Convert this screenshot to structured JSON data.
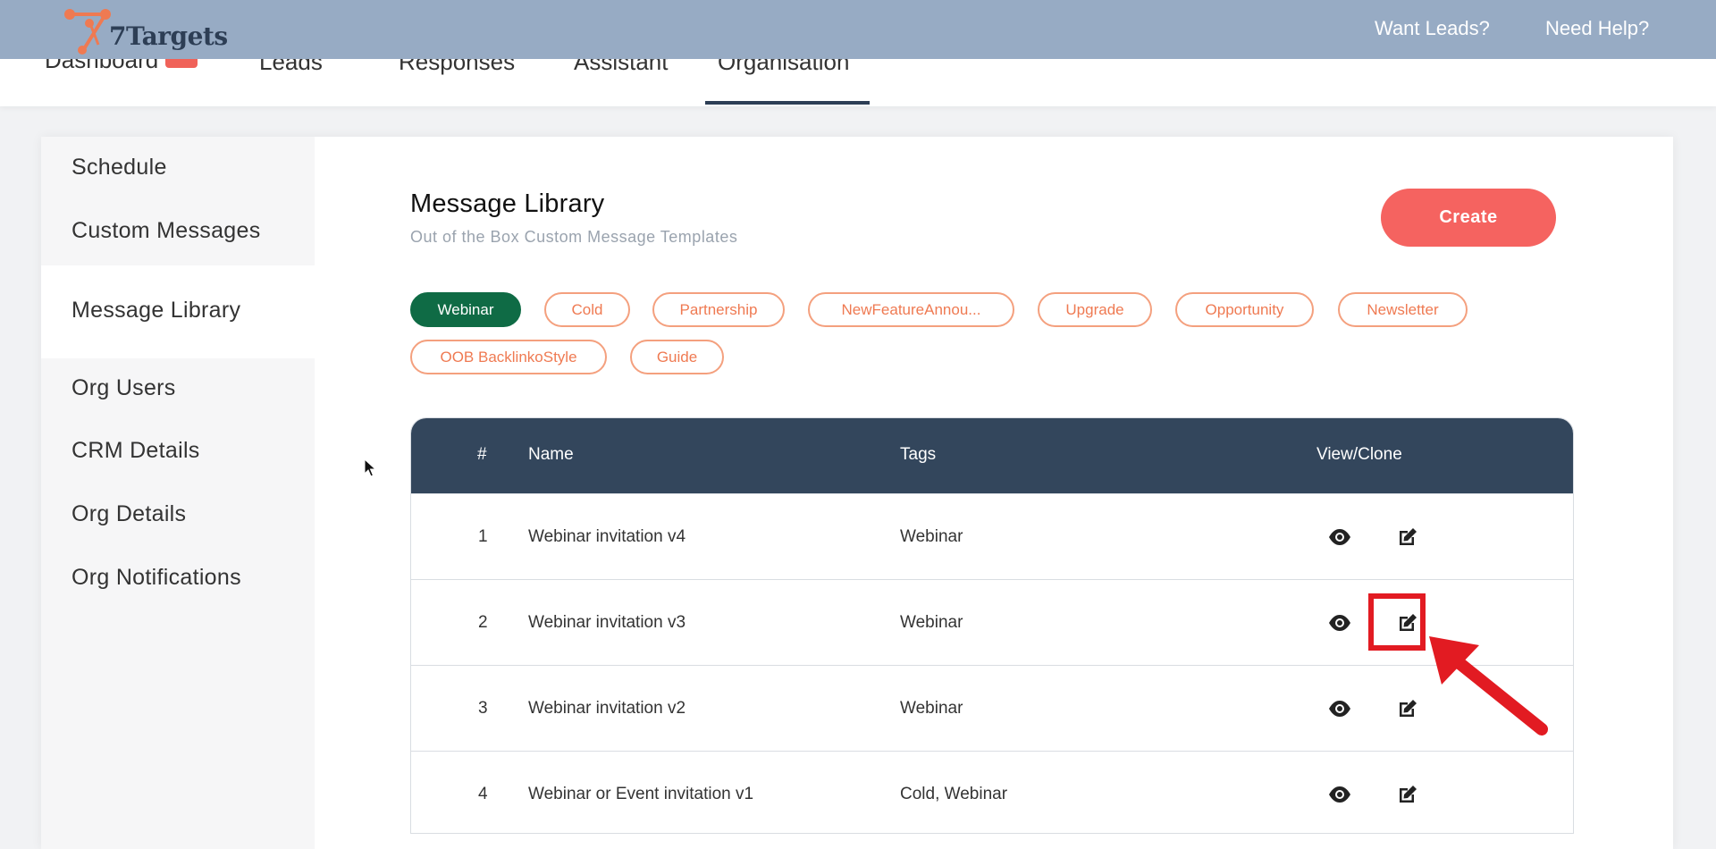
{
  "header": {
    "logo_text": "7Targets",
    "links": [
      "Want Leads?",
      "Need Help?"
    ]
  },
  "nav": {
    "tabs": [
      "Dashboard",
      "Leads",
      "Responses",
      "Assistant",
      "Organisation"
    ],
    "active": "Organisation"
  },
  "sidebar": {
    "items": [
      "Schedule",
      "Custom Messages",
      "Message Library",
      "Org Users",
      "CRM Details",
      "Org Details",
      "Org Notifications"
    ],
    "active": "Message Library"
  },
  "main": {
    "title": "Message Library",
    "subtitle": "Out of the Box Custom Message Templates",
    "create_label": "Create",
    "tags": [
      "Webinar",
      "Cold",
      "Partnership",
      "NewFeatureAnnou...",
      "Upgrade",
      "Opportunity",
      "Newsletter",
      "OOB BacklinkoStyle",
      "Guide"
    ],
    "active_tag": "Webinar"
  },
  "table": {
    "headers": [
      "#",
      "Name",
      "Tags",
      "View/Clone"
    ],
    "rows": [
      {
        "num": "1",
        "name": "Webinar invitation v4",
        "tags": "Webinar"
      },
      {
        "num": "2",
        "name": "Webinar invitation v3",
        "tags": "Webinar"
      },
      {
        "num": "3",
        "name": "Webinar invitation v2",
        "tags": "Webinar"
      },
      {
        "num": "4",
        "name": "Webinar or Event invitation v1",
        "tags": "Cold, Webinar"
      }
    ]
  },
  "icons": {
    "view": "eye-icon",
    "clone": "edit-icon"
  },
  "colors": {
    "header_bg": "#97abc4",
    "accent": "#f56360",
    "active_tag": "#0f6b45",
    "table_header": "#33465c",
    "annotation": "#e21b22"
  }
}
